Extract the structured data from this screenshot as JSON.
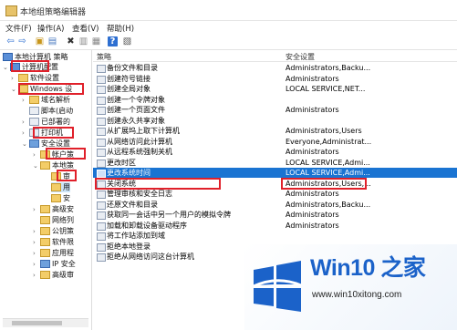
{
  "window": {
    "title": "本地组策略编辑器"
  },
  "menu": [
    "文件(F)",
    "操作(A)",
    "查看(V)",
    "帮助(H)"
  ],
  "toolbar": {
    "icons": [
      "back-arrow-icon",
      "forward-arrow-icon",
      "folder-up-icon",
      "show-tree-icon",
      "delete-icon",
      "properties-icon",
      "export-icon",
      "help-icon",
      "filter-icon"
    ],
    "glyphs": [
      "⇦",
      "⇨",
      "▣",
      "▤",
      "✖",
      "▥",
      "▦",
      "?",
      "▧"
    ]
  },
  "tree": {
    "items": [
      {
        "exp": "",
        "label": "本地计算机 策略",
        "icon": "pc"
      },
      {
        "exp": "⌄",
        "label": "计算机配置",
        "icon": "pc"
      },
      {
        "exp": "›",
        "label": "软件设置",
        "icon": "folder"
      },
      {
        "exp": "⌄",
        "label": "Windows 设",
        "icon": "folder"
      },
      {
        "exp": "›",
        "label": "域名解析",
        "icon": "folder"
      },
      {
        "exp": "",
        "label": "脚本(启动",
        "icon": "pol"
      },
      {
        "exp": "›",
        "label": "已部署的",
        "icon": "pol"
      },
      {
        "exp": "›",
        "label": "打印机",
        "icon": "pol"
      },
      {
        "exp": "⌄",
        "label": "安全设置",
        "icon": "sec"
      },
      {
        "exp": "›",
        "label": "帐户策",
        "icon": "folder"
      },
      {
        "exp": "⌄",
        "label": "本地策",
        "icon": "folder"
      },
      {
        "exp": "",
        "label": "审",
        "icon": "folder"
      },
      {
        "exp": "",
        "label": "用",
        "icon": "folder"
      },
      {
        "exp": "",
        "label": "安",
        "icon": "folder"
      },
      {
        "exp": "›",
        "label": "高级安",
        "icon": "folder"
      },
      {
        "exp": "",
        "label": "网络列",
        "icon": "folder"
      },
      {
        "exp": "›",
        "label": "公钥策",
        "icon": "folder"
      },
      {
        "exp": "›",
        "label": "软件限",
        "icon": "folder"
      },
      {
        "exp": "›",
        "label": "应用程",
        "icon": "folder"
      },
      {
        "exp": "›",
        "label": "IP 安全",
        "icon": "sec"
      },
      {
        "exp": "›",
        "label": "高级审",
        "icon": "folder"
      }
    ]
  },
  "list": {
    "headers": [
      "策略",
      "安全设置"
    ],
    "rows": [
      {
        "name": "备份文件和目录",
        "setting": "Administrators,Backu..."
      },
      {
        "name": "创建符号链接",
        "setting": "Administrators"
      },
      {
        "name": "创建全局对象",
        "setting": "LOCAL SERVICE,NET..."
      },
      {
        "name": "创建一个令牌对象",
        "setting": ""
      },
      {
        "name": "创建一个页面文件",
        "setting": "Administrators"
      },
      {
        "name": "创建永久共享对象",
        "setting": ""
      },
      {
        "name": "从扩展坞上取下计算机",
        "setting": "Administrators,Users"
      },
      {
        "name": "从网络访问此计算机",
        "setting": "Everyone,Administrat..."
      },
      {
        "name": "从远程系统强制关机",
        "setting": "Administrators"
      },
      {
        "name": "更改时区",
        "setting": "LOCAL SERVICE,Admi..."
      },
      {
        "name": "更改系统时间",
        "setting": "LOCAL SERVICE,Admi..."
      },
      {
        "name": "关闭系统",
        "setting": "Administrators,Users,..."
      },
      {
        "name": "管理审核和安全日志",
        "setting": "Administrators"
      },
      {
        "name": "还原文件和目录",
        "setting": "Administrators,Backu..."
      },
      {
        "name": "获取同一会话中另一个用户的模拟令牌",
        "setting": "Administrators"
      },
      {
        "name": "加载和卸载设备驱动程序",
        "setting": "Administrators"
      },
      {
        "name": "将工作站添加到域",
        "setting": ""
      },
      {
        "name": "拒绝本地登录",
        "setting": ""
      },
      {
        "name": "拒绝从网络访问这台计算机",
        "setting": ""
      }
    ],
    "selected_index": 10
  },
  "watermark": {
    "title": "Win10 之家",
    "url": "www.win10xitong.com"
  },
  "colors": {
    "selection": "#1a74d2",
    "highlight_box": "#e0202a",
    "logo_blue": "#1b62c9"
  }
}
